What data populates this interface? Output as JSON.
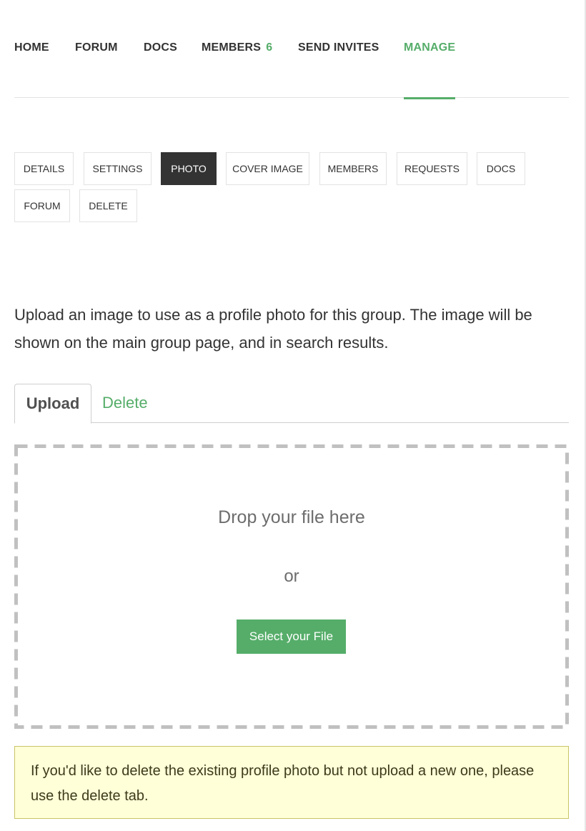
{
  "primary_nav": {
    "home": "HOME",
    "forum": "FORUM",
    "docs": "DOCS",
    "members": "MEMBERS",
    "members_count": "6",
    "send_invites": "SEND INVITES",
    "manage": "MANAGE"
  },
  "sub_nav": {
    "details": "DETAILS",
    "settings": "SETTINGS",
    "photo": "PHOTO",
    "cover_image": "COVER IMAGE",
    "members": "MEMBERS",
    "requests": "REQUESTS",
    "docs": "DOCS",
    "forum": "FORUM",
    "delete": "DELETE"
  },
  "intro_text": "Upload an image to use as a profile photo for this group. The image will be shown on the main group page, and in search results.",
  "tabs": {
    "upload": "Upload",
    "delete": "Delete"
  },
  "dropzone": {
    "drop_text": "Drop your file here",
    "or_text": "or",
    "select_button": "Select your File"
  },
  "notice": "If you'd like to delete the existing profile photo but not upload a new one, please use the delete tab.",
  "colors": {
    "accent": "#55ad69",
    "dark": "#333333",
    "notice_bg": "#ffffd8"
  }
}
